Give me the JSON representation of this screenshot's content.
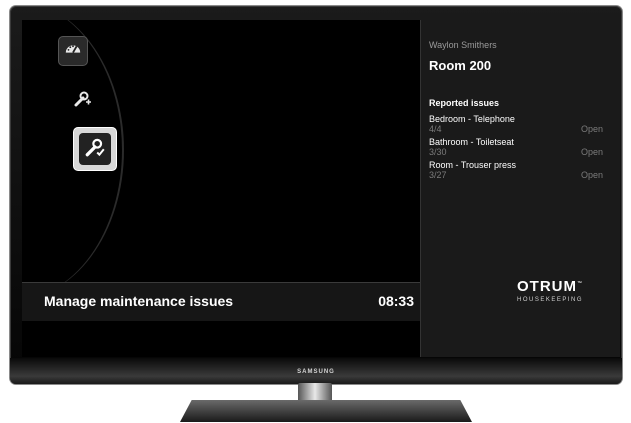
{
  "device": {
    "brand": "SAMSUNG"
  },
  "nav": {
    "items": [
      {
        "icon": "speedometer-icon"
      },
      {
        "icon": "add-wrench-icon"
      },
      {
        "icon": "wrench-check-icon",
        "selected": true
      }
    ]
  },
  "footer": {
    "title": "Manage maintenance issues",
    "time": "08:33"
  },
  "details": {
    "guest_name": "Waylon Smithers",
    "room": "Room 200",
    "issues_heading": "Reported issues",
    "issues": [
      {
        "name": "Bedroom - Telephone",
        "qty": "4/4",
        "status": "Open"
      },
      {
        "name": "Bathroom - Toiletseat",
        "qty": "3/30",
        "status": "Open"
      },
      {
        "name": "Room - Trouser press",
        "qty": "3/27",
        "status": "Open"
      }
    ]
  },
  "logo": {
    "word": "OTRUM",
    "tm": "™",
    "sub": "HOUSEKEEPING"
  }
}
